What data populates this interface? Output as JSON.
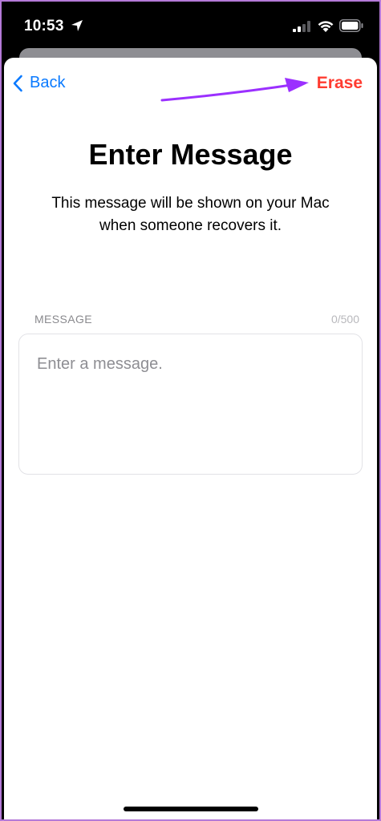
{
  "status_bar": {
    "time": "10:53",
    "icons": [
      "location-arrow-icon",
      "cellular-signal-icon",
      "wifi-icon",
      "battery-icon"
    ]
  },
  "nav": {
    "back_label": "Back",
    "erase_label": "Erase"
  },
  "page": {
    "title": "Enter Message",
    "subtitle": "This message will be shown on your Mac when someone recovers it."
  },
  "message_field": {
    "label": "MESSAGE",
    "counter": "0/500",
    "value": "",
    "placeholder": "Enter a message."
  },
  "colors": {
    "accent_blue": "#0a7aff",
    "destructive_red": "#ff3b30",
    "annotation_purple": "#9b30ff",
    "frame_border": "#b57ad8"
  }
}
